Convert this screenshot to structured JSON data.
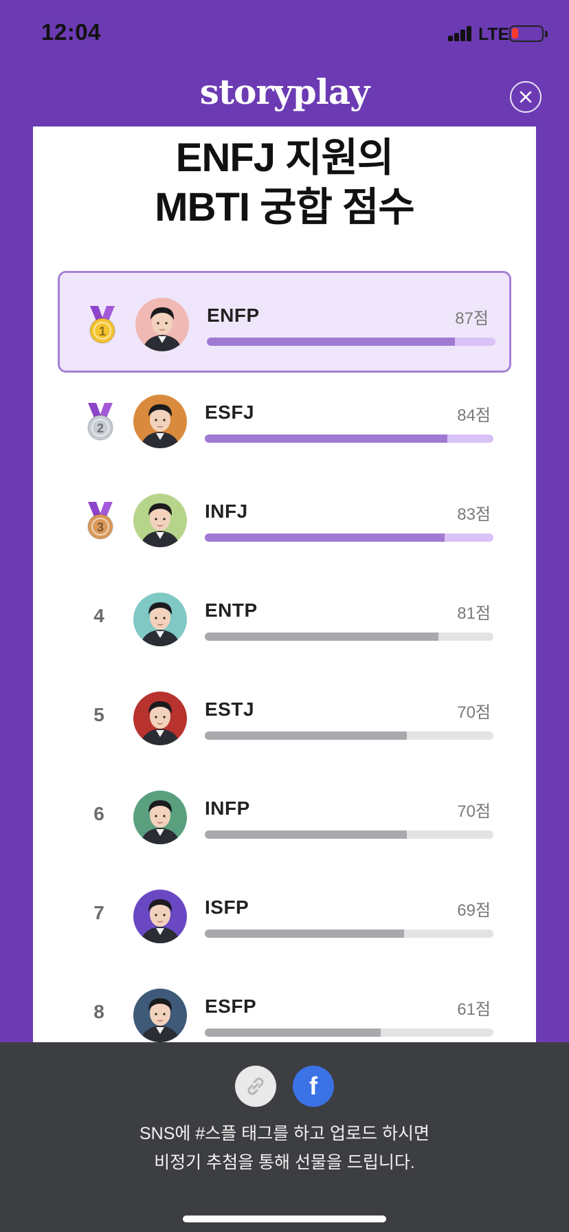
{
  "status_bar": {
    "time": "12:04",
    "network": "LTE"
  },
  "header": {
    "logo": "storyplay",
    "close_icon": "close-icon"
  },
  "card": {
    "title_line1": "ENFJ 지원의",
    "title_line2": "MBTI 궁합 점수"
  },
  "colors": {
    "background": "#6c3bb3",
    "highlight_bg": "#efe6fb",
    "highlight_border": "#a680d6",
    "top_bar_fill": "#a07ad2",
    "top_bar_track": "#d9c2f5",
    "rest_bar_fill": "#a8a8ad",
    "rest_bar_track": "#e3e3e6",
    "share_panel": "#3d3e42",
    "facebook": "#3b72e6"
  },
  "rankings": [
    {
      "rank": "1",
      "medal": "gold-medal-icon",
      "mbti": "ENFP",
      "score": "87점",
      "fraction": 0.86
    },
    {
      "rank": "2",
      "medal": "silver-medal-icon",
      "mbti": "ESFJ",
      "score": "84점",
      "fraction": 0.84
    },
    {
      "rank": "3",
      "medal": "bronze-medal-icon",
      "mbti": "INFJ",
      "score": "83점",
      "fraction": 0.83
    },
    {
      "rank": "4",
      "mbti": "ENTP",
      "score": "81점",
      "fraction": 0.81
    },
    {
      "rank": "5",
      "mbti": "ESTJ",
      "score": "70점",
      "fraction": 0.7
    },
    {
      "rank": "6",
      "mbti": "INFP",
      "score": "70점",
      "fraction": 0.7
    },
    {
      "rank": "7",
      "mbti": "ISFP",
      "score": "69점",
      "fraction": 0.69
    },
    {
      "rank": "8",
      "mbti": "ESFP",
      "score": "61점",
      "fraction": 0.61
    }
  ],
  "share": {
    "link_icon": "link-icon",
    "facebook_label": "f",
    "message_line1": "SNS에 #스플 태그를 하고 업로드 하시면",
    "message_line2": "비정기 추첨을 통해 선물을 드립니다."
  }
}
